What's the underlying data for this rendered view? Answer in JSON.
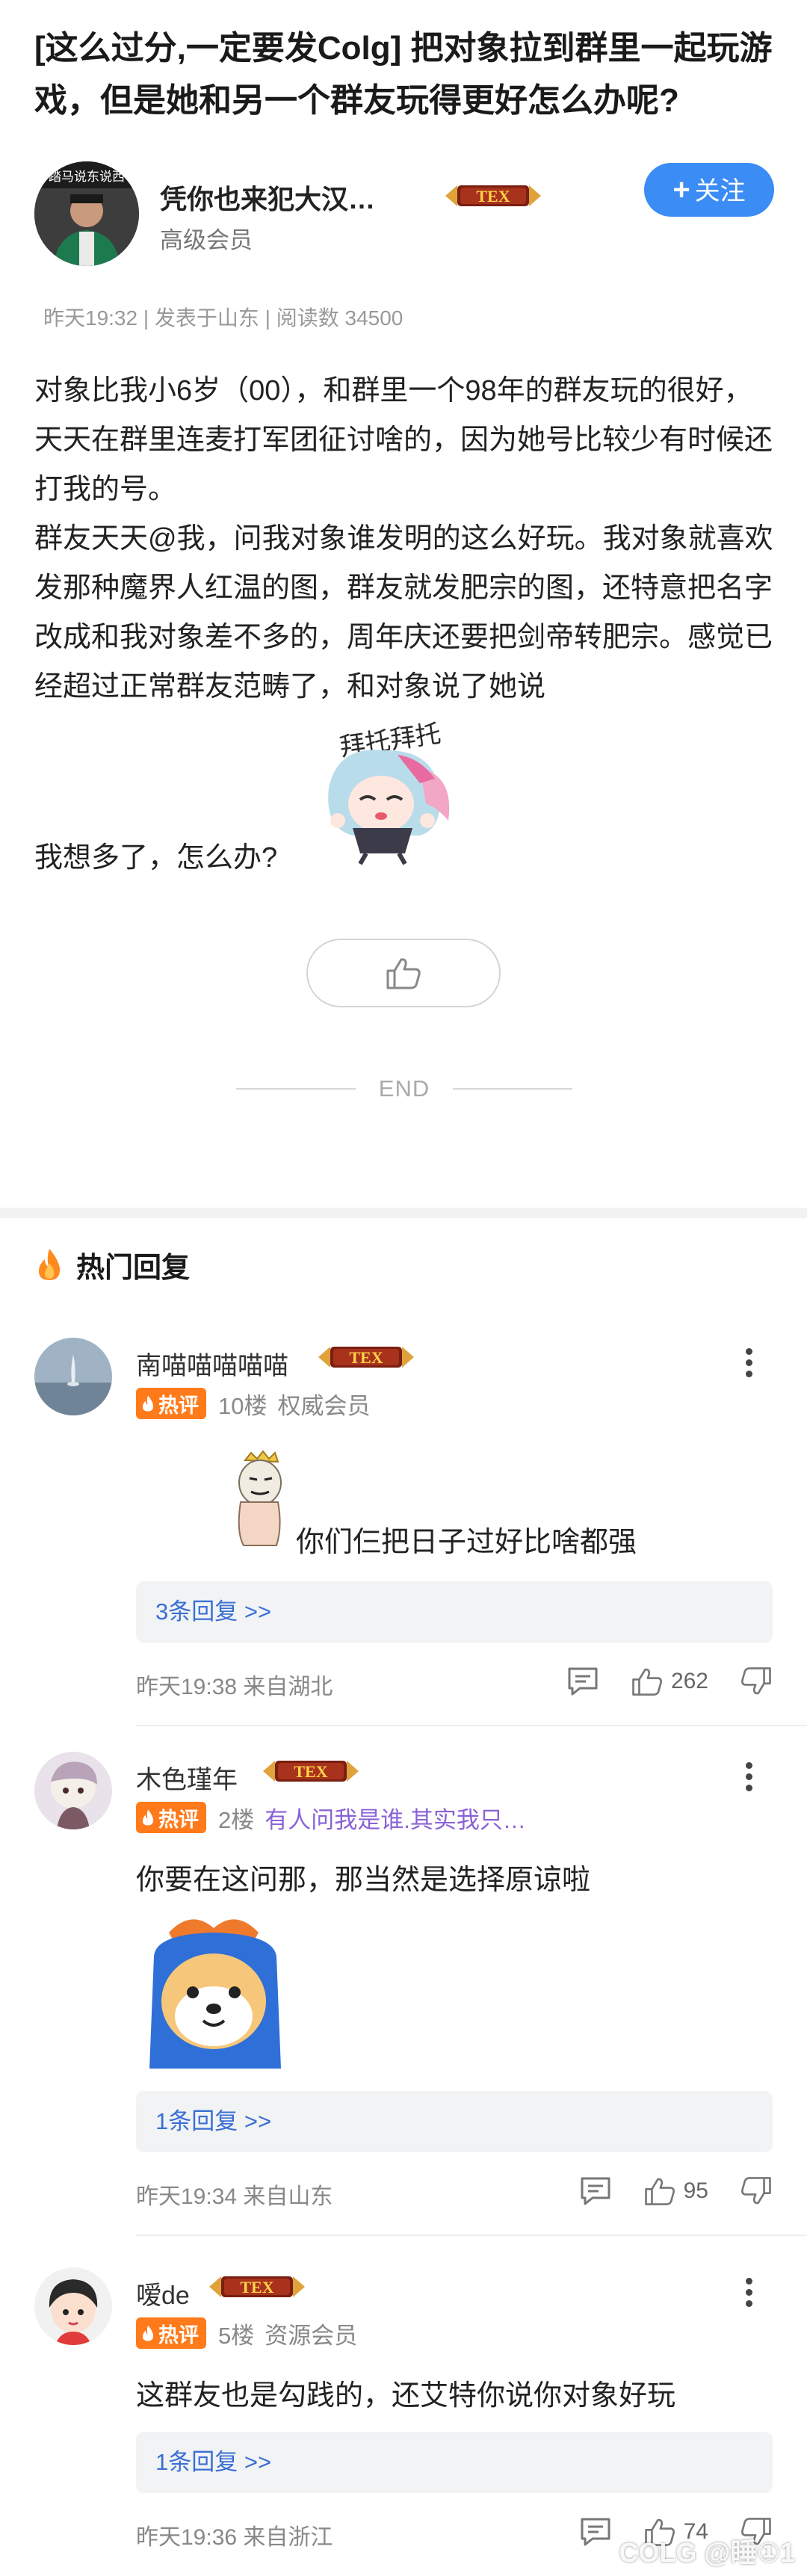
{
  "post": {
    "title": "[这么过分,一定要发Colg] 把对象拉到群里一起玩游戏，但是她和另一个群友玩得更好怎么办呢?",
    "author": {
      "name": "凭你也来犯大汉…",
      "level_text": "高级会员",
      "follow_label": "关注",
      "badge_text": "TEX",
      "avatar_sign": "踏马说东说西"
    },
    "meta": "昨天19:32 | 发表于山东 | 阅读数 34500",
    "paragraphs": [
      "对象比我小6岁（00），和群里一个98年的群友玩的很好，天天在群里连麦打军团征讨啥的，因为她号比较少有时候还打我的号。",
      "群友天天@我，问我对象谁发明的这么好玩。我对象就喜欢发那种魔界人红温的图，群友就发肥宗的图，还特意把名字改成和我对象差不多的，周年庆还要把剑帝转肥宗。感觉已经超过正常群友范畴了，和对象说了她说"
    ],
    "sticker_text": "拜托拜托",
    "last_line": "我想多了，怎么办?",
    "end_text": "END"
  },
  "hot_section": {
    "title": "热门回复"
  },
  "hot_tag_label": "热评",
  "comments": [
    {
      "name": "南喵喵喵喵喵",
      "badge_text": "TEX",
      "floor": "10楼",
      "rank": "权威会员",
      "quote": "",
      "text": "你们仨把日子过好比啥都强",
      "replies_label": "3条回复 >>",
      "time": "昨天19:38 来自湖北",
      "likes": "262"
    },
    {
      "name": "木色瑾年",
      "badge_text": "TEX",
      "floor": "2楼",
      "rank": "",
      "quote": "有人问我是谁.其实我只…",
      "text": "你要在这问那，那当然是选择原谅啦",
      "replies_label": "1条回复 >>",
      "time": "昨天19:34 来自山东",
      "likes": "95"
    },
    {
      "name": "嗳de",
      "badge_text": "TEX",
      "floor": "5楼",
      "rank": "资源会员",
      "quote": "",
      "text": "这群友也是勾践的，还艾特你说你对象好玩",
      "replies_label": "1条回复 >>",
      "time": "昨天19:36 来自浙江",
      "likes": "74"
    }
  ],
  "watermark": "COLG @睡①1",
  "colors": {
    "accent_blue": "#3b8cf5",
    "hot_orange": "#ff7a1a",
    "link_blue": "#3a6fd4",
    "quote_purple": "#8a62d6"
  }
}
